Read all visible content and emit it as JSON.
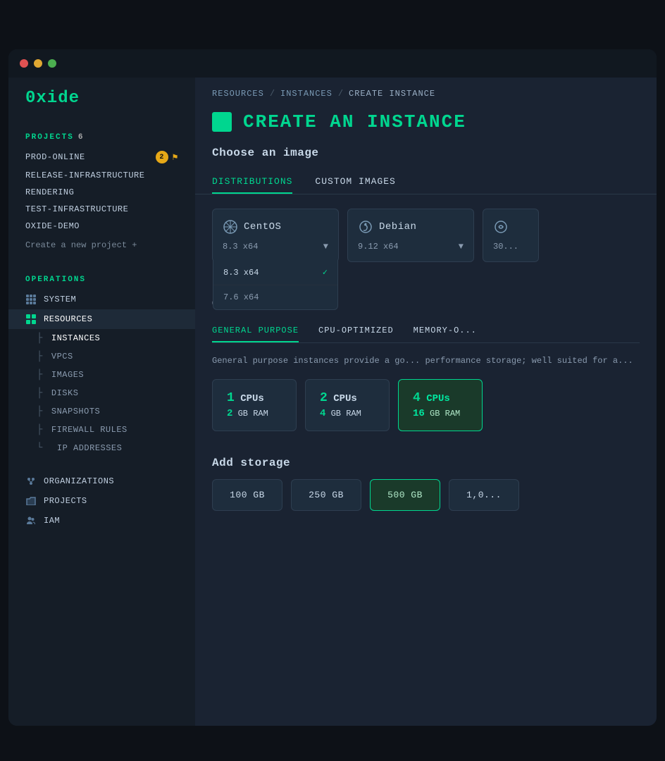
{
  "app": {
    "logo": "0xide"
  },
  "sidebar": {
    "projects_label": "PROJECTS",
    "projects_count": "6",
    "projects": [
      {
        "name": "PROD-ONLINE",
        "badge_count": "2",
        "bookmarked": true
      },
      {
        "name": "RELEASE-INFRASTRUCTURE",
        "badge_count": null,
        "bookmarked": false
      },
      {
        "name": "RENDERING",
        "badge_count": null,
        "bookmarked": false
      },
      {
        "name": "TEST-INFRASTRUCTURE",
        "badge_count": null,
        "bookmarked": false
      },
      {
        "name": "OXIDE-DEMO",
        "badge_count": null,
        "bookmarked": false
      }
    ],
    "create_project_label": "Create a new project +",
    "operations_label": "OPERATIONS",
    "nav": [
      {
        "id": "system",
        "label": "SYSTEM",
        "icon": "grid"
      },
      {
        "id": "resources",
        "label": "RESOURCES",
        "icon": "grid2",
        "active": true
      }
    ],
    "sub_nav": [
      {
        "id": "instances",
        "label": "INSTANCES",
        "connector": "├",
        "active": true
      },
      {
        "id": "vpcs",
        "label": "VPCS",
        "connector": "├"
      },
      {
        "id": "images",
        "label": "IMAGES",
        "connector": "├"
      },
      {
        "id": "disks",
        "label": "DISKS",
        "connector": "├"
      },
      {
        "id": "snapshots",
        "label": "SNAPSHOTS",
        "connector": "├"
      },
      {
        "id": "firewall-rules",
        "label": "FIREWALL RULES",
        "connector": "├"
      },
      {
        "id": "ip-addresses",
        "label": "IP ADDRESSES",
        "connector": "└"
      }
    ],
    "bottom_nav": [
      {
        "id": "organizations",
        "label": "ORGANIZATIONS",
        "icon": "org"
      },
      {
        "id": "projects",
        "label": "PROJECTS",
        "icon": "folder"
      },
      {
        "id": "iam",
        "label": "IAM",
        "icon": "iam"
      }
    ]
  },
  "main": {
    "breadcrumb": {
      "resources": "RESOURCES",
      "sep1": "/",
      "instances": "INSTANCES",
      "sep2": "/",
      "current": "CREATE INSTANCE"
    },
    "page_title": "CREATE AN INSTANCE",
    "choose_image_label": "Choose an image",
    "image_tabs": [
      {
        "id": "distributions",
        "label": "DISTRIBUTIONS",
        "active": true
      },
      {
        "id": "custom-images",
        "label": "CUSTOM IMAGES",
        "active": false
      }
    ],
    "image_cards": [
      {
        "id": "centos",
        "name": "CentOS",
        "version": "8.3 x64",
        "icon": "centos"
      },
      {
        "id": "debian",
        "name": "Debian",
        "version": "9.12 x64",
        "icon": "debian"
      },
      {
        "id": "third",
        "name": "...",
        "version": "30...",
        "icon": "generic"
      }
    ],
    "dropdown": {
      "items": [
        {
          "label": "8.3 x64",
          "selected": true
        },
        {
          "label": "7.6 x64",
          "selected": false
        }
      ]
    },
    "cpu_ram_label": "CPUs and RAM",
    "instance_tabs": [
      {
        "id": "general-purpose",
        "label": "GENERAL PURPOSE",
        "active": true
      },
      {
        "id": "cpu-optimized",
        "label": "CPU-OPTIMIZED",
        "active": false
      },
      {
        "id": "memory-optimized",
        "label": "MEMORY-O...",
        "active": false
      }
    ],
    "instance_description": "General purpose instances provide a go... performance storage; well suited for a...",
    "cpu_cards": [
      {
        "cpus": "1",
        "ram": "2",
        "selected": false
      },
      {
        "cpus": "2",
        "ram": "4",
        "selected": false
      },
      {
        "cpus": "4",
        "ram": "16",
        "selected": true
      }
    ],
    "add_storage_label": "Add storage",
    "storage_cards": [
      {
        "label": "100 GB",
        "selected": false
      },
      {
        "label": "250 GB",
        "selected": false
      },
      {
        "label": "500 GB",
        "selected": true
      },
      {
        "label": "1,0...",
        "selected": false
      }
    ]
  }
}
